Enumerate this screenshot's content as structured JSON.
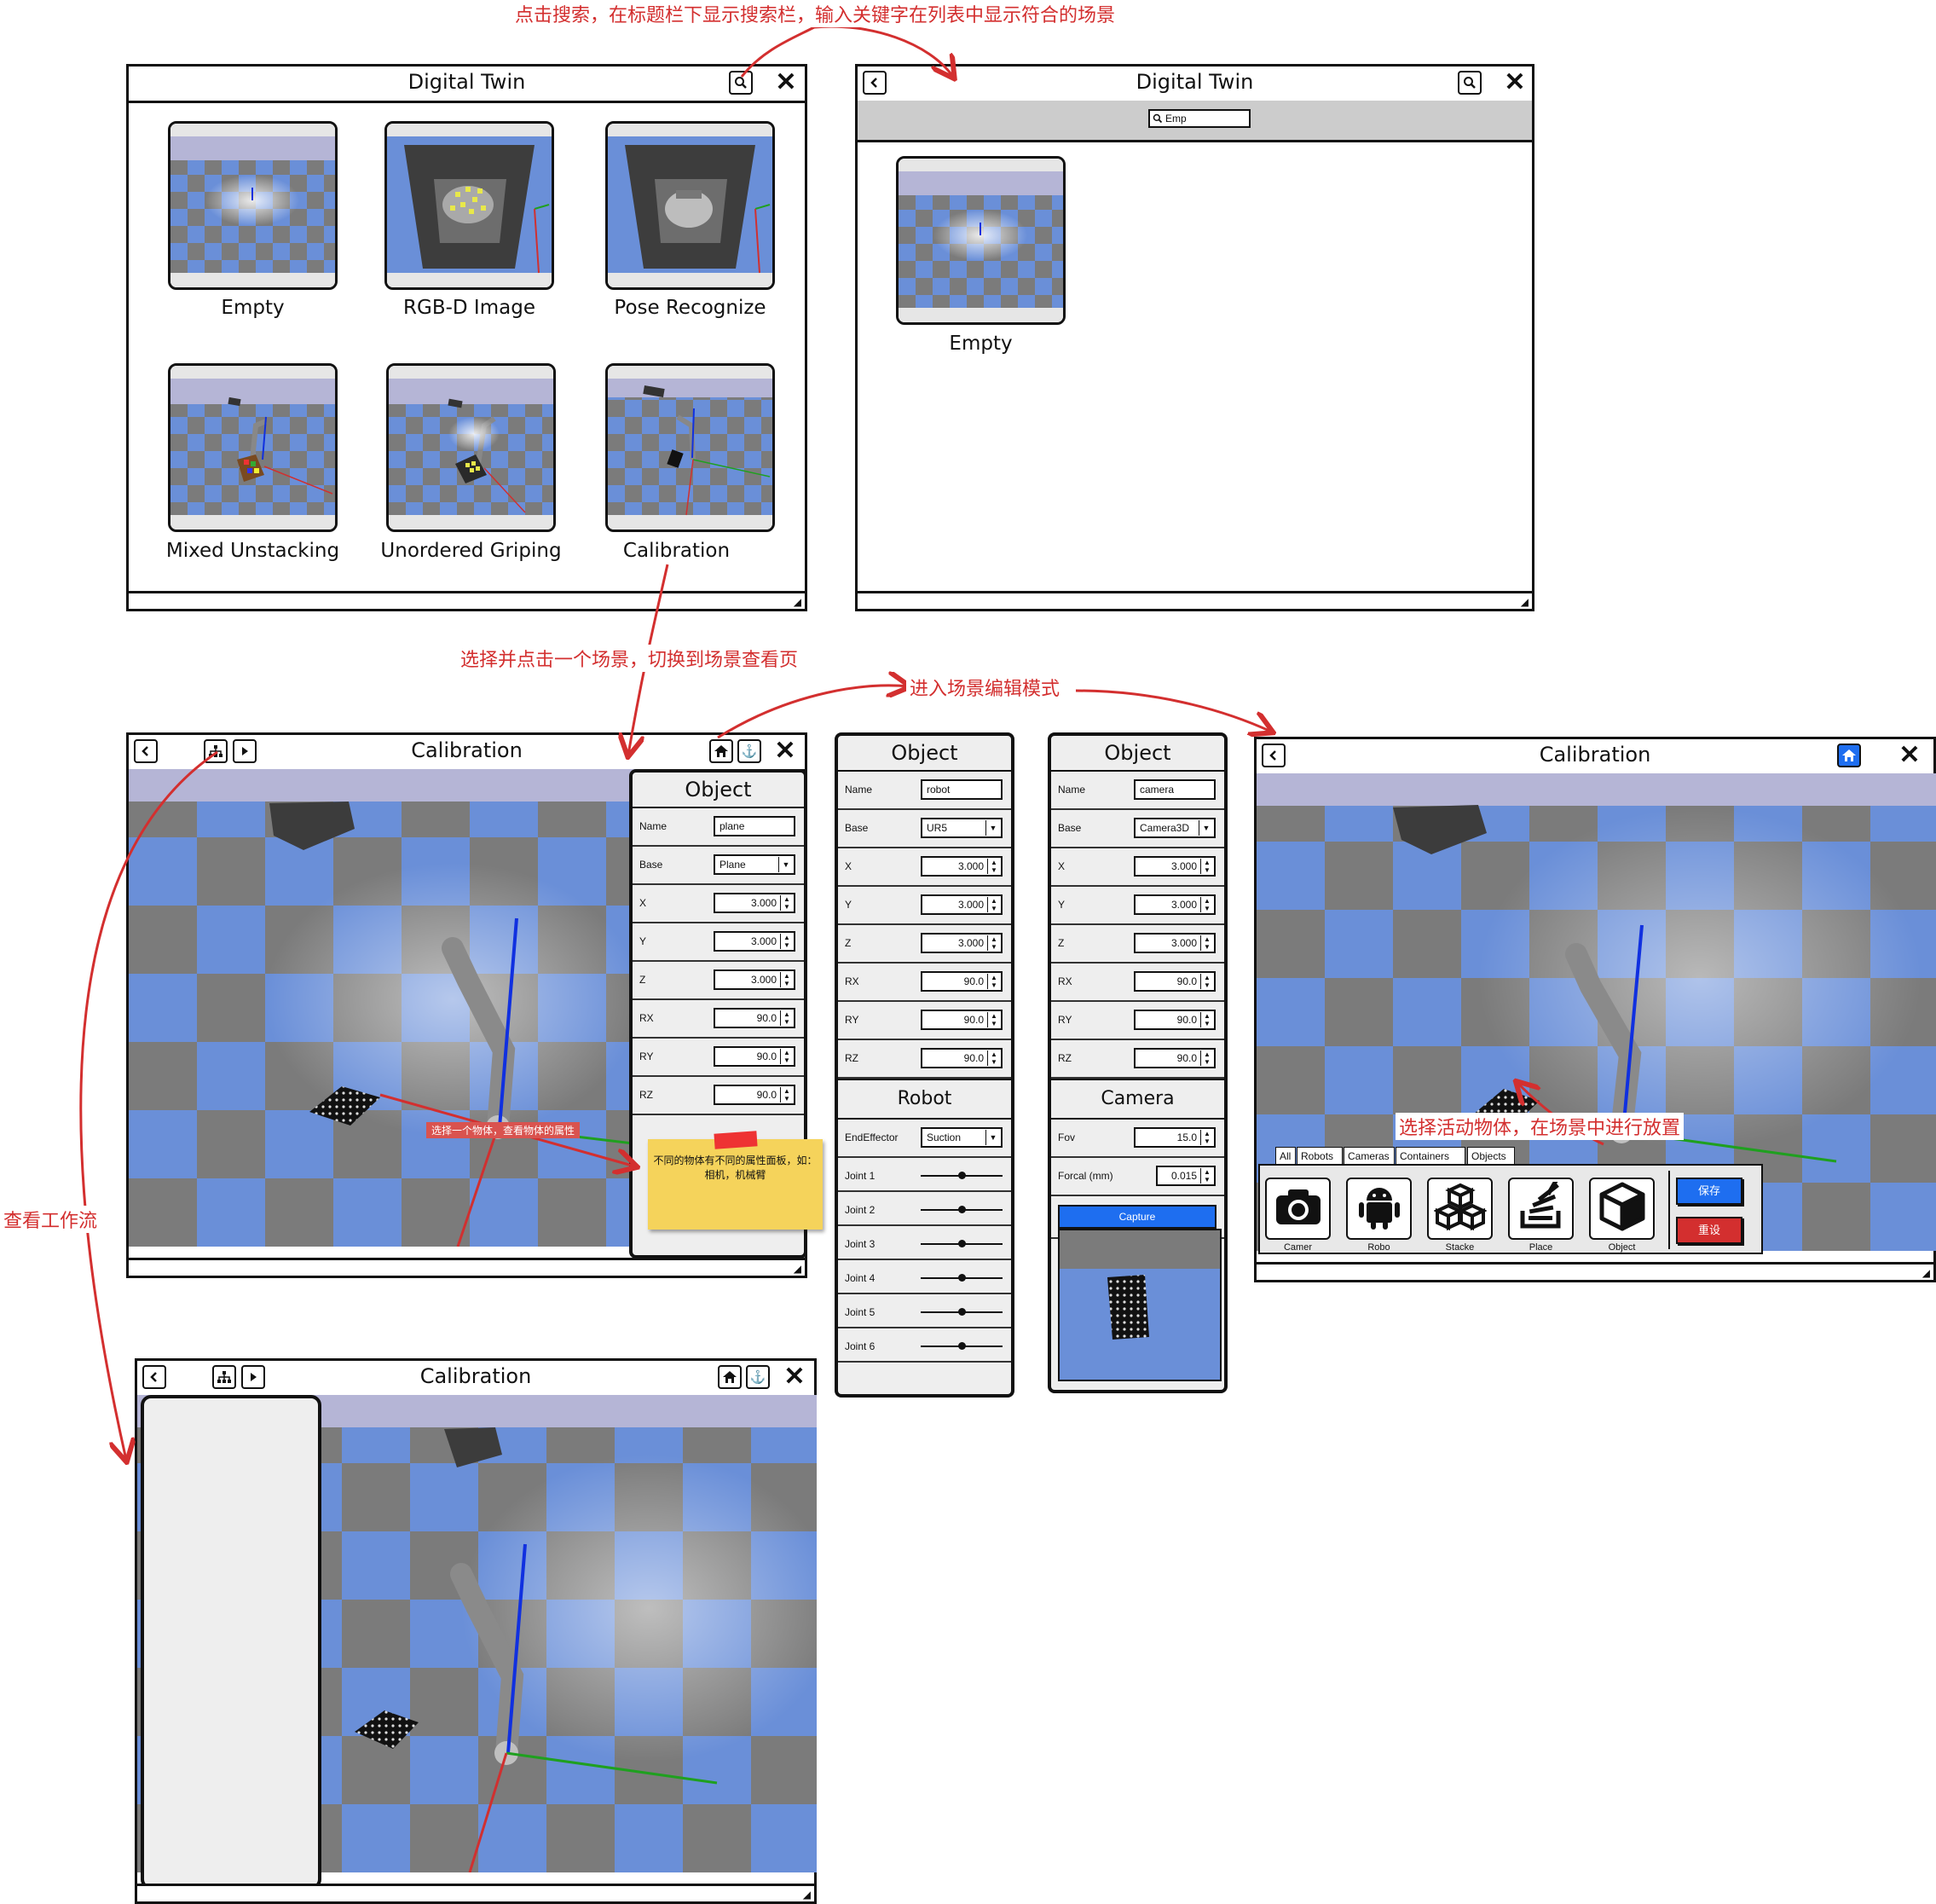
{
  "colors": {
    "accent": "#1e6ef0",
    "danger": "#d32f2f",
    "annotation": "#d32f2f",
    "sticky": "#f5d35b",
    "floor_blue": "#6a8fd8",
    "floor_gray": "#7b7b7b",
    "sky": "#b5b5d6"
  },
  "annotations": {
    "search": "点击搜索，在标题栏下显示搜索栏，输入关键字在列表中显示符合的场景",
    "select_scene": "选择并点击一个场景，切换到场景查看页",
    "edit_mode": "进入场景编辑模式",
    "workflow": "查看工作流",
    "place_object": "选择活动物体，在场景中进行放置",
    "select_object_hint": "选择一个物体，查看物体的属性",
    "sticky_note": "不同的物体有不同的属性面板，如：相机，机械臂"
  },
  "gallery": {
    "title": "Digital Twin",
    "icons": {
      "search": "search-icon",
      "close": "close-icon"
    },
    "scenes": [
      {
        "label": "Empty"
      },
      {
        "label": "RGB-D Image"
      },
      {
        "label": "Pose Recognize"
      },
      {
        "label": "Mixed Unstacking"
      },
      {
        "label": "Unordered Griping"
      },
      {
        "label": "Calibration"
      }
    ]
  },
  "search_view": {
    "title": "Digital Twin",
    "search_value": "Emp",
    "results": [
      {
        "label": "Empty"
      }
    ]
  },
  "scene_view": {
    "title": "Calibration",
    "object_panel": {
      "title": "Object",
      "fields": [
        {
          "label": "Name",
          "value": "plane",
          "kind": "text"
        },
        {
          "label": "Base",
          "value": "Plane",
          "kind": "select"
        },
        {
          "label": "X",
          "value": "3.000",
          "kind": "number"
        },
        {
          "label": "Y",
          "value": "3.000",
          "kind": "number"
        },
        {
          "label": "Z",
          "value": "3.000",
          "kind": "number"
        },
        {
          "label": "RX",
          "value": "90.0",
          "kind": "number"
        },
        {
          "label": "RY",
          "value": "90.0",
          "kind": "number"
        },
        {
          "label": "RZ",
          "value": "90.0",
          "kind": "number"
        }
      ]
    }
  },
  "robot_panel": {
    "title": "Object",
    "fields": [
      {
        "label": "Name",
        "value": "robot",
        "kind": "text"
      },
      {
        "label": "Base",
        "value": "UR5",
        "kind": "select"
      },
      {
        "label": "X",
        "value": "3.000",
        "kind": "number"
      },
      {
        "label": "Y",
        "value": "3.000",
        "kind": "number"
      },
      {
        "label": "Z",
        "value": "3.000",
        "kind": "number"
      },
      {
        "label": "RX",
        "value": "90.0",
        "kind": "number"
      },
      {
        "label": "RY",
        "value": "90.0",
        "kind": "number"
      },
      {
        "label": "RZ",
        "value": "90.0",
        "kind": "number"
      }
    ],
    "section_title": "Robot",
    "end_effector": {
      "label": "EndEffector",
      "value": "Suction"
    },
    "joints": [
      "Joint 1",
      "Joint 2",
      "Joint 3",
      "Joint 4",
      "Joint 5",
      "Joint 6"
    ]
  },
  "camera_panel": {
    "title": "Object",
    "fields": [
      {
        "label": "Name",
        "value": "camera",
        "kind": "text"
      },
      {
        "label": "Base",
        "value": "Camera3D",
        "kind": "select"
      },
      {
        "label": "X",
        "value": "3.000",
        "kind": "number"
      },
      {
        "label": "Y",
        "value": "3.000",
        "kind": "number"
      },
      {
        "label": "Z",
        "value": "3.000",
        "kind": "number"
      },
      {
        "label": "RX",
        "value": "90.0",
        "kind": "number"
      },
      {
        "label": "RY",
        "value": "90.0",
        "kind": "number"
      },
      {
        "label": "RZ",
        "value": "90.0",
        "kind": "number"
      }
    ],
    "section_title": "Camera",
    "fov": {
      "label": "Fov",
      "value": "15.0"
    },
    "focal": {
      "label": "Forcal (mm)",
      "value": "0.015"
    },
    "capture_label": "Capture"
  },
  "edit_view": {
    "title": "Calibration",
    "tabs": [
      "All",
      "Robots",
      "Cameras",
      "Containers",
      "Objects"
    ],
    "tools": [
      {
        "label": "Camer",
        "icon": "camera-icon"
      },
      {
        "label": "Robo",
        "icon": "android-icon"
      },
      {
        "label": "Stacke",
        "icon": "cubes-icon"
      },
      {
        "label": "Place",
        "icon": "stack-icon"
      },
      {
        "label": "Object",
        "icon": "cube-icon"
      }
    ],
    "save_label": "保存",
    "reset_label": "重设"
  },
  "workflow_view": {
    "title": "Calibration"
  }
}
